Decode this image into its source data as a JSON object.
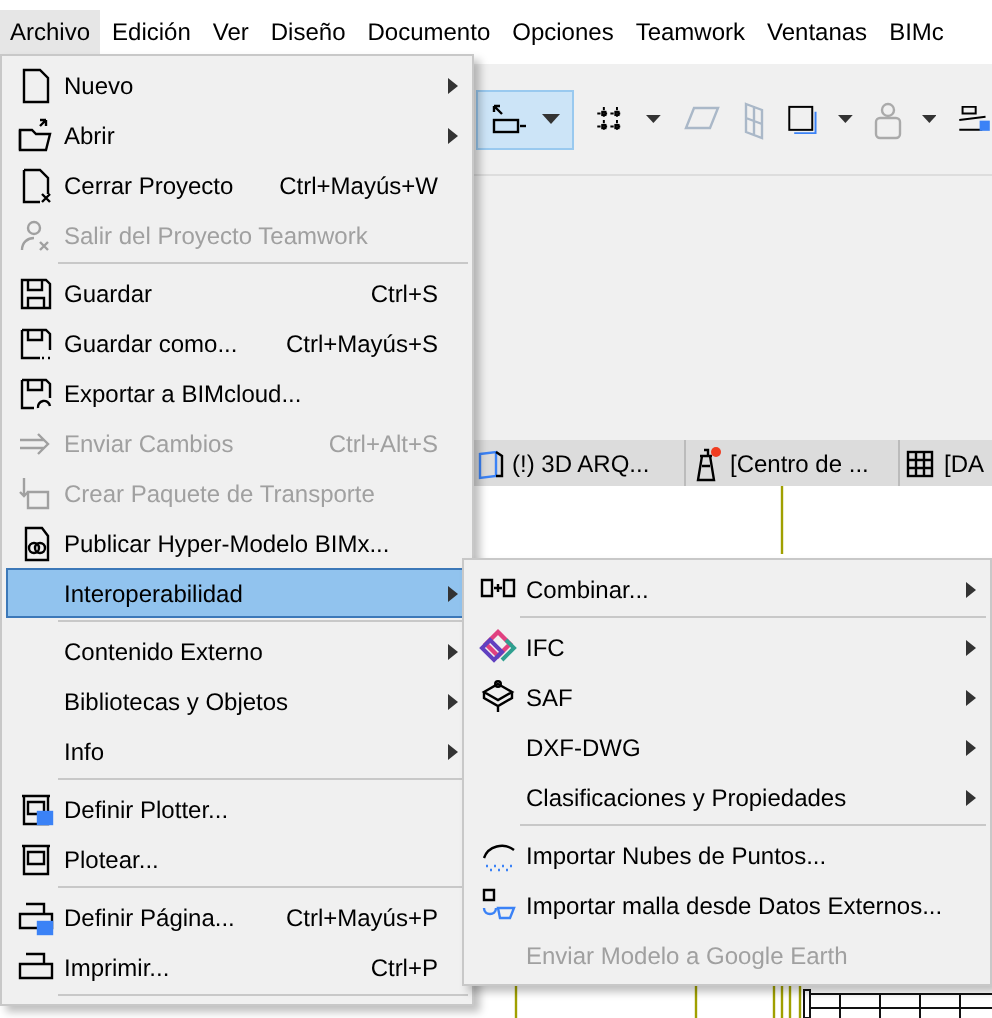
{
  "menubar": [
    {
      "label": "Archivo",
      "selected": true
    },
    {
      "label": "Edición",
      "selected": false
    },
    {
      "label": "Ver",
      "selected": false
    },
    {
      "label": "Diseño",
      "selected": false
    },
    {
      "label": "Documento",
      "selected": false
    },
    {
      "label": "Opciones",
      "selected": false
    },
    {
      "label": "Teamwork",
      "selected": false
    },
    {
      "label": "Ventanas",
      "selected": false
    },
    {
      "label": "BIMc",
      "selected": false
    }
  ],
  "view_tabs": [
    {
      "label": "(!) 3D ARQ..."
    },
    {
      "label": "[Centro de ..."
    },
    {
      "label": "[DA"
    }
  ],
  "file_menu": {
    "items": [
      {
        "kind": "item",
        "label": "Nuevo",
        "has_submenu": true,
        "disabled": false,
        "selected": false
      },
      {
        "kind": "item",
        "label": "Abrir",
        "has_submenu": true,
        "disabled": false,
        "selected": false
      },
      {
        "kind": "item",
        "label": "Cerrar Proyecto",
        "shortcut": "Ctrl+Mayús+W",
        "has_submenu": false,
        "disabled": false,
        "selected": false
      },
      {
        "kind": "item",
        "label": "Salir del Proyecto Teamwork",
        "has_submenu": false,
        "disabled": true,
        "selected": false
      },
      {
        "kind": "separator"
      },
      {
        "kind": "item",
        "label": "Guardar",
        "shortcut": "Ctrl+S",
        "has_submenu": false,
        "disabled": false,
        "selected": false
      },
      {
        "kind": "item",
        "label": "Guardar como...",
        "shortcut": "Ctrl+Mayús+S",
        "has_submenu": false,
        "disabled": false,
        "selected": false
      },
      {
        "kind": "item",
        "label": "Exportar a BIMcloud...",
        "has_submenu": false,
        "disabled": false,
        "selected": false
      },
      {
        "kind": "item",
        "label": "Enviar Cambios",
        "shortcut": "Ctrl+Alt+S",
        "has_submenu": false,
        "disabled": true,
        "selected": false
      },
      {
        "kind": "item",
        "label": "Crear Paquete de Transporte",
        "has_submenu": false,
        "disabled": true,
        "selected": false
      },
      {
        "kind": "item",
        "label": "Publicar Hyper-Modelo BIMx...",
        "has_submenu": false,
        "disabled": false,
        "selected": false
      },
      {
        "kind": "item",
        "label": "Interoperabilidad",
        "has_submenu": true,
        "disabled": false,
        "selected": true
      },
      {
        "kind": "separator"
      },
      {
        "kind": "item",
        "label": "Contenido Externo",
        "has_submenu": true,
        "disabled": false,
        "selected": false
      },
      {
        "kind": "item",
        "label": "Bibliotecas y Objetos",
        "has_submenu": true,
        "disabled": false,
        "selected": false
      },
      {
        "kind": "item",
        "label": "Info",
        "has_submenu": true,
        "disabled": false,
        "selected": false
      },
      {
        "kind": "separator"
      },
      {
        "kind": "item",
        "label": "Definir Plotter...",
        "has_submenu": false,
        "disabled": false,
        "selected": false
      },
      {
        "kind": "item",
        "label": "Plotear...",
        "has_submenu": false,
        "disabled": false,
        "selected": false
      },
      {
        "kind": "separator"
      },
      {
        "kind": "item",
        "label": "Definir Página...",
        "shortcut": "Ctrl+Mayús+P",
        "has_submenu": false,
        "disabled": false,
        "selected": false
      },
      {
        "kind": "item",
        "label": "Imprimir...",
        "shortcut": "Ctrl+P",
        "has_submenu": false,
        "disabled": false,
        "selected": false
      },
      {
        "kind": "separator"
      }
    ]
  },
  "interoperability_submenu": {
    "items": [
      {
        "kind": "item",
        "label": "Combinar...",
        "has_submenu": true,
        "disabled": false,
        "selected": false
      },
      {
        "kind": "separator"
      },
      {
        "kind": "item",
        "label": "IFC",
        "has_submenu": true,
        "disabled": false,
        "selected": false
      },
      {
        "kind": "item",
        "label": "SAF",
        "has_submenu": true,
        "disabled": false,
        "selected": false
      },
      {
        "kind": "item",
        "label": "DXF-DWG",
        "has_submenu": true,
        "disabled": false,
        "selected": false
      },
      {
        "kind": "item",
        "label": "Clasificaciones y Propiedades",
        "has_submenu": true,
        "disabled": false,
        "selected": false
      },
      {
        "kind": "separator"
      },
      {
        "kind": "item",
        "label": "Importar Nubes de Puntos...",
        "has_submenu": false,
        "disabled": false,
        "selected": false
      },
      {
        "kind": "item",
        "label": "Importar malla desde Datos Externos...",
        "has_submenu": false,
        "disabled": false,
        "selected": false
      },
      {
        "kind": "item",
        "label": "Enviar Modelo a Google Earth",
        "has_submenu": false,
        "disabled": true,
        "selected": false
      }
    ]
  }
}
